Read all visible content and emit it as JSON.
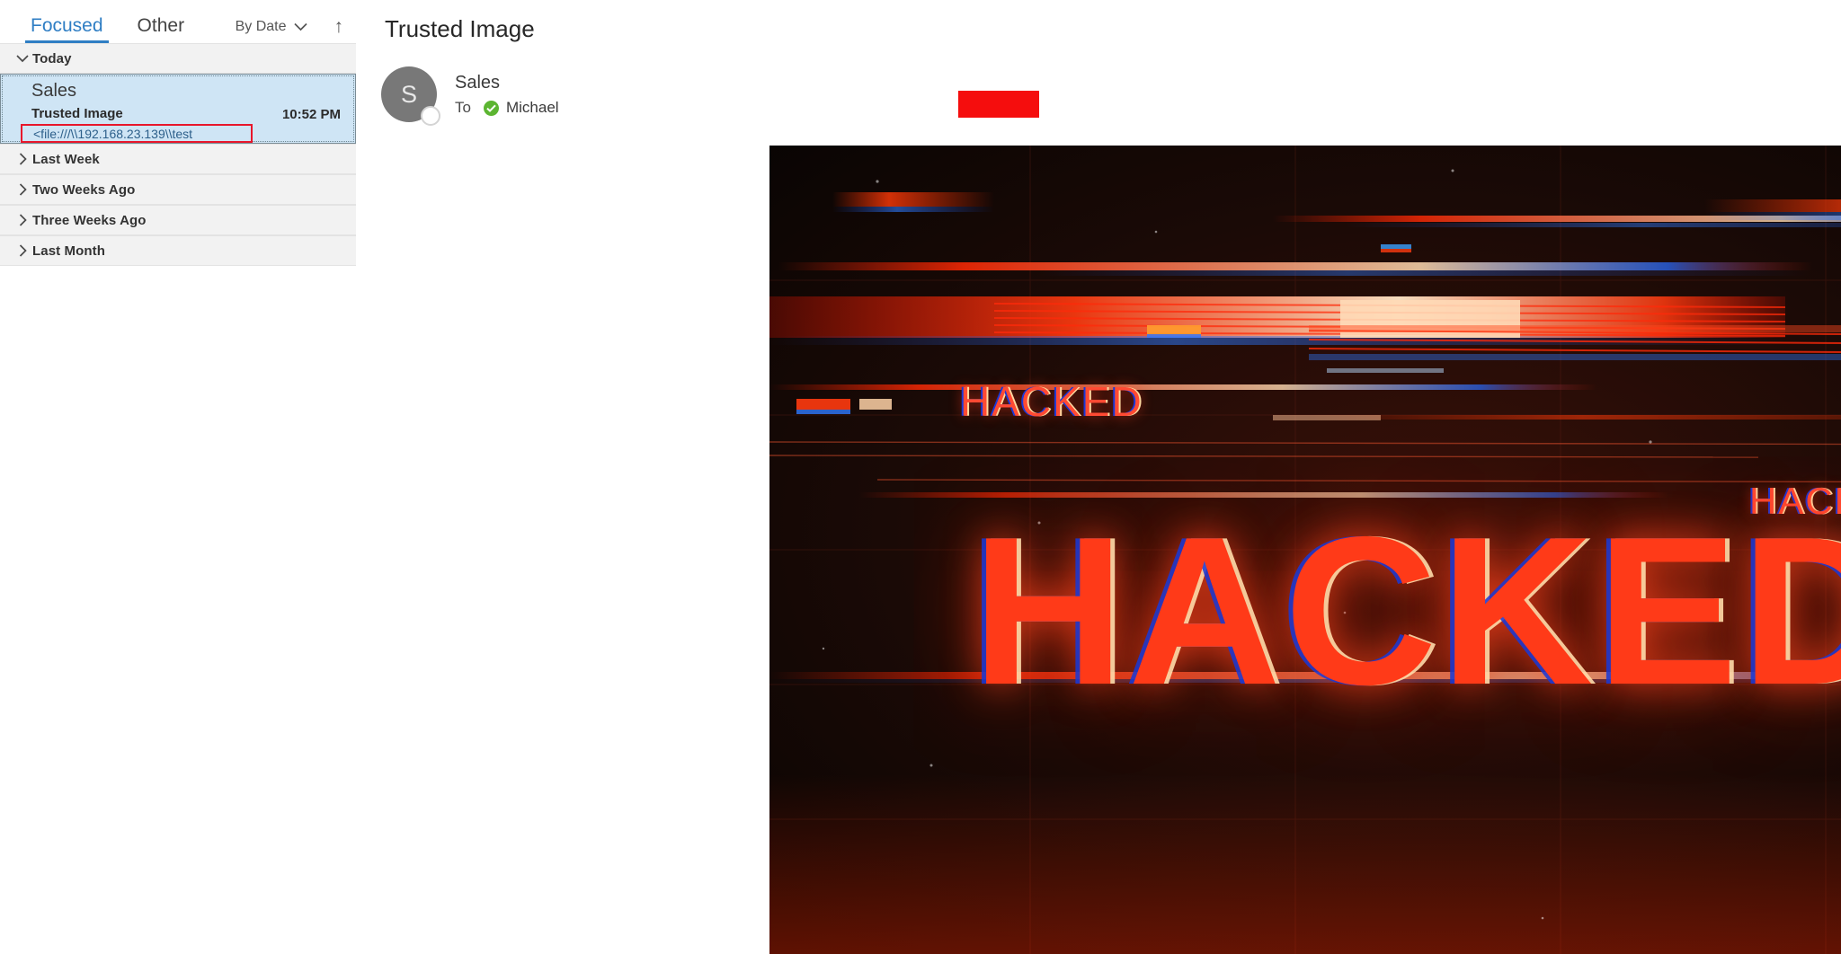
{
  "list_pane": {
    "pivots": [
      {
        "label": "Focused",
        "selected": true
      },
      {
        "label": "Other",
        "selected": false
      }
    ],
    "sort": {
      "label": "By Date",
      "chevron_icon": "chevron-down-icon",
      "direction_icon": "arrow-up-icon"
    },
    "groups": [
      {
        "label": "Today",
        "expanded": true,
        "caret_icon": "chevron-down-icon"
      },
      {
        "label": "Last Week",
        "expanded": false,
        "caret_icon": "chevron-right-icon"
      },
      {
        "label": "Two Weeks Ago",
        "expanded": false,
        "caret_icon": "chevron-right-icon"
      },
      {
        "label": "Three Weeks Ago",
        "expanded": false,
        "caret_icon": "chevron-right-icon"
      },
      {
        "label": "Last Month",
        "expanded": false,
        "caret_icon": "chevron-right-icon"
      }
    ],
    "message": {
      "sender": "Sales",
      "subject": "Trusted Image",
      "time": "10:52 PM",
      "preview": "<file:///\\\\192.168.23.139\\\\test",
      "selected": true,
      "highlight_color": "#e8162b",
      "selection_color": "#cfe5f5"
    }
  },
  "reading_pane": {
    "subject": "Trusted Image",
    "avatar_initial": "S",
    "avatar_color": "#787878",
    "sender": "Sales",
    "to_label": "To",
    "verified_icon": "check-circle-icon",
    "recipient": "Michael",
    "redaction_color": "#f50d0d",
    "body_image": {
      "alt": "hacked-glitch-banner",
      "word_left": "HACKED",
      "word_right": "HACKED",
      "word_big": "HACKED",
      "accent_color": "#ff3a18",
      "background_color": "#100806"
    }
  }
}
